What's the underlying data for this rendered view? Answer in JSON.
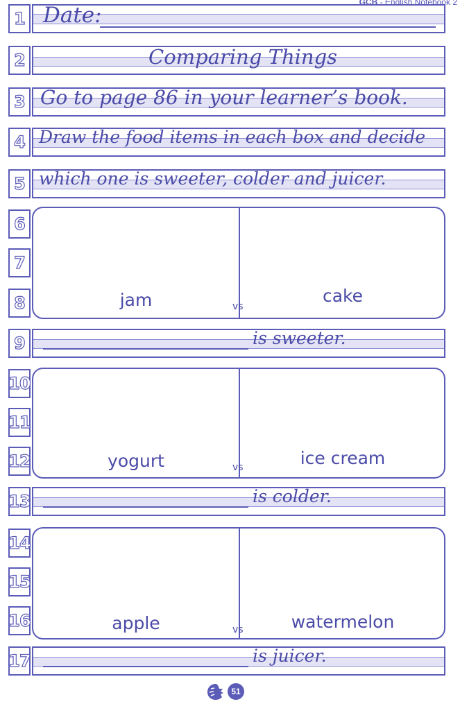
{
  "header": {
    "brand": "GCB",
    "separator": " - ",
    "title": "English Notebook 2"
  },
  "line_numbers": [
    "1",
    "2",
    "3",
    "4",
    "5",
    "6",
    "7",
    "8",
    "9",
    "10",
    "11",
    "12",
    "13",
    "14",
    "15",
    "16",
    "17"
  ],
  "lines": {
    "date_label": "Date:",
    "title": "Comparing Things",
    "instruction_1": "Go to page 86 in your learner’s book.",
    "instruction_2": "Draw the food items in each box and decide",
    "instruction_3": "which one is sweeter, colder and juicer."
  },
  "comparisons": [
    {
      "left": "jam",
      "right": "cake",
      "vs": "vs",
      "answer_suffix": "is sweeter."
    },
    {
      "left": "yogurt",
      "right": "ice cream",
      "vs": "vs",
      "answer_suffix": "is colder."
    },
    {
      "left": "apple",
      "right": "watermelon",
      "vs": "vs",
      "answer_suffix": "is juicer."
    }
  ],
  "footer": {
    "page_number": "51",
    "logo_icon": "lion-head-icon"
  },
  "colors": {
    "ink": "#5b5bb8",
    "band": "#e3e3f5"
  }
}
